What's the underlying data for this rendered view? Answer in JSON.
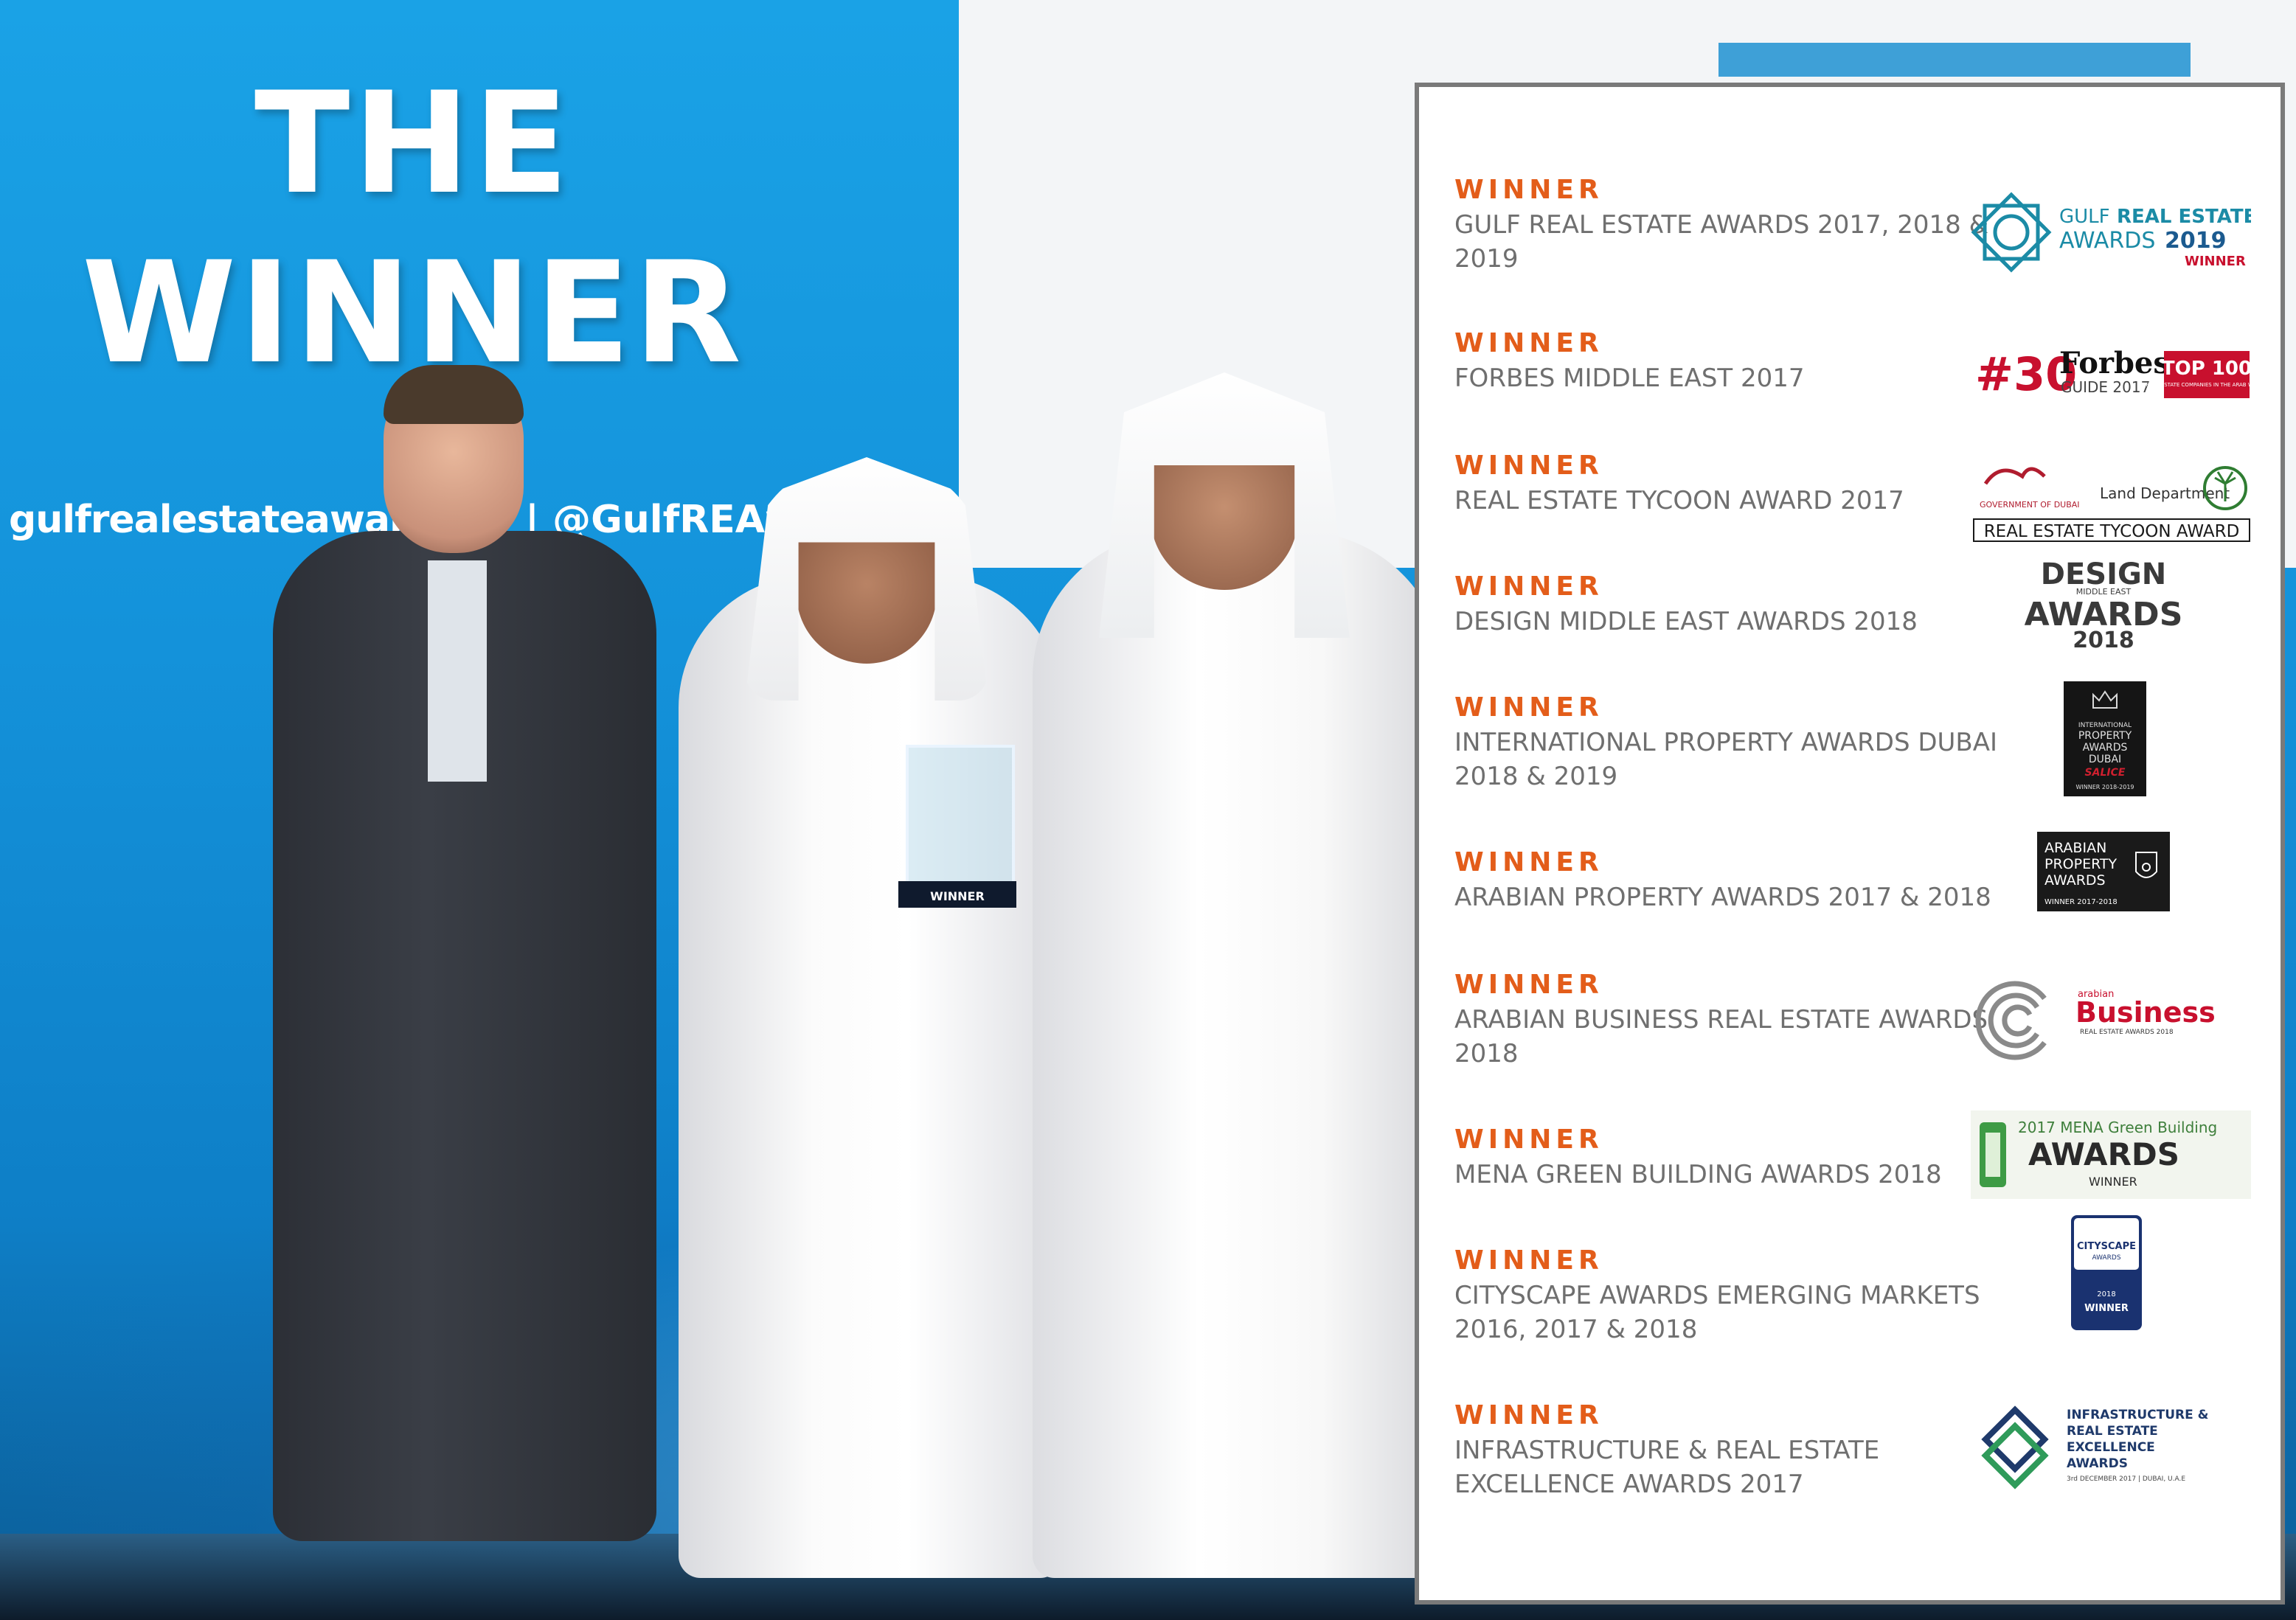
{
  "photo": {
    "screen_title_line1": "THE",
    "screen_title_line2": "WINNER",
    "hashtag": "gulfrealestateawards",
    "handle": "| @GulfREAwa",
    "trophy_text": "WINNER"
  },
  "awards": [
    {
      "label": "WINNER",
      "name": "GULF REAL ESTATE AWARDS 2017, 2018 & 2019",
      "logo": {
        "icon": "star-knot-emblem-icon",
        "line1a": "GULF",
        "line1b": "REAL ESTATE",
        "line2a": "AWARDS",
        "line2b": "2019",
        "line3": "WINNER"
      }
    },
    {
      "label": "WINNER",
      "name": "FORBES MIDDLE EAST 2017",
      "logo": {
        "rank": "#30",
        "brand": "Forbes",
        "guide": "GUIDE 2017",
        "badge": "TOP 100",
        "badge_sub": "REAL ESTATE COMPANIES IN THE ARAB WORLD"
      }
    },
    {
      "label": "WINNER",
      "name": "REAL ESTATE TYCOON AWARD 2017",
      "logo": {
        "icon": "palm-seal-icon",
        "gov": "GOVERNMENT OF DUBAI",
        "dept": "Land Department",
        "ribbon": "REAL ESTATE TYCOON AWARD"
      }
    },
    {
      "label": "WINNER",
      "name": "DESIGN MIDDLE EAST AWARDS 2018",
      "logo": {
        "line1": "DESIGN",
        "line2": "MIDDLE EAST",
        "line3": "AWARDS",
        "line4": "2018"
      }
    },
    {
      "label": "WINNER",
      "name": "INTERNATIONAL PROPERTY AWARDS DUBAI 2018 & 2019",
      "logo": {
        "line1": "INTERNATIONAL",
        "line2": "PROPERTY",
        "line3": "AWARDS",
        "line4": "DUBAI",
        "brand": "SALICE",
        "footer": "WINNER 2018-2019"
      }
    },
    {
      "label": "WINNER",
      "name": "ARABIAN PROPERTY AWARDS 2017 & 2018",
      "logo": {
        "line1": "ARABIAN",
        "line2": "PROPERTY",
        "line3": "AWARDS",
        "footer": "WINNER 2017-2018",
        "icon": "crest-icon"
      }
    },
    {
      "label": "WINNER",
      "name": "ARABIAN BUSINESS REAL ESTATE AWARDS 2018",
      "logo": {
        "icon": "swirl-arcs-icon",
        "pre": "arabian",
        "brand": "Business",
        "sub": "REAL ESTATE AWARDS 2018"
      }
    },
    {
      "label": "WINNER",
      "name": "MENA GREEN BUILDING AWARDS 2018",
      "logo": {
        "icon": "green-building-icon",
        "line1": "2017 MENA Green Building",
        "line2": "AWARDS",
        "line3": "WINNER"
      }
    },
    {
      "label": "WINNER",
      "name": "CITYSCAPE AWARDS EMERGING MARKETS 2016, 2017 & 2018",
      "logo": {
        "brand": "CITYSCAPE",
        "sub": "AWARDS",
        "year": "2018",
        "footer": "WINNER"
      }
    },
    {
      "label": "WINNER",
      "name": "INFRASTRUCTURE & REAL ESTATE EXCELLENCE AWARDS 2017",
      "logo": {
        "icon": "stacked-diamonds-icon",
        "line1": "INFRASTRUCTURE &",
        "line2": "REAL ESTATE",
        "line3": "EXCELLENCE",
        "line4": "AWARDS",
        "line5": "3rd DECEMBER 2017 | DUBAI, U.A.E"
      }
    }
  ]
}
